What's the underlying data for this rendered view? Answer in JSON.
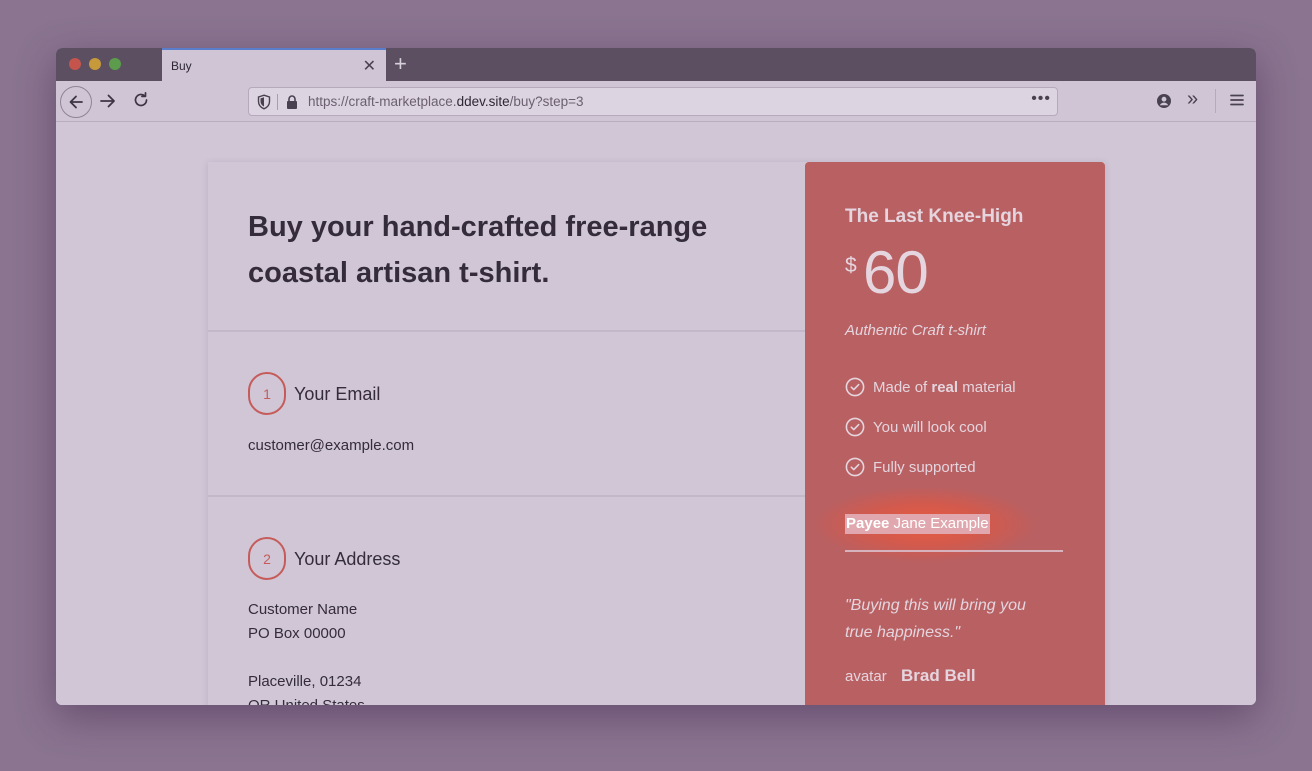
{
  "browser": {
    "tab_title": "Buy",
    "url_prefix": "https://craft-marketplace.",
    "url_host": "ddev.site",
    "url_path": "/buy?step=3"
  },
  "page": {
    "headline": "Buy your hand-crafted free-range coastal artisan t-shirt.",
    "steps": [
      {
        "number": "1",
        "title": "Your Email"
      },
      {
        "number": "2",
        "title": "Your Address"
      }
    ],
    "email": "customer@example.com",
    "address": {
      "name": "Customer Name",
      "line1": "PO Box 00000",
      "city_line": "Placeville, 01234",
      "country_line": "OR United States"
    }
  },
  "product": {
    "name": "The Last Knee-High",
    "currency": "$",
    "price": "60",
    "subtitle": "Authentic Craft t-shirt",
    "features": [
      {
        "pre": "Made of ",
        "bold": "real",
        "post": " material"
      },
      {
        "pre": "You will look cool",
        "bold": "",
        "post": ""
      },
      {
        "pre": "Fully supported",
        "bold": "",
        "post": ""
      }
    ],
    "payee_label": "Payee",
    "payee_name": "Jane Example",
    "quote": "\"Buying this will bring you true happiness.\"",
    "avatar_alt": "avatar",
    "author": "Brad Bell"
  },
  "colors": {
    "accent": "#c65c5a",
    "sidebar_bg": "#b96062",
    "page_bg": "#d0c6d6"
  }
}
